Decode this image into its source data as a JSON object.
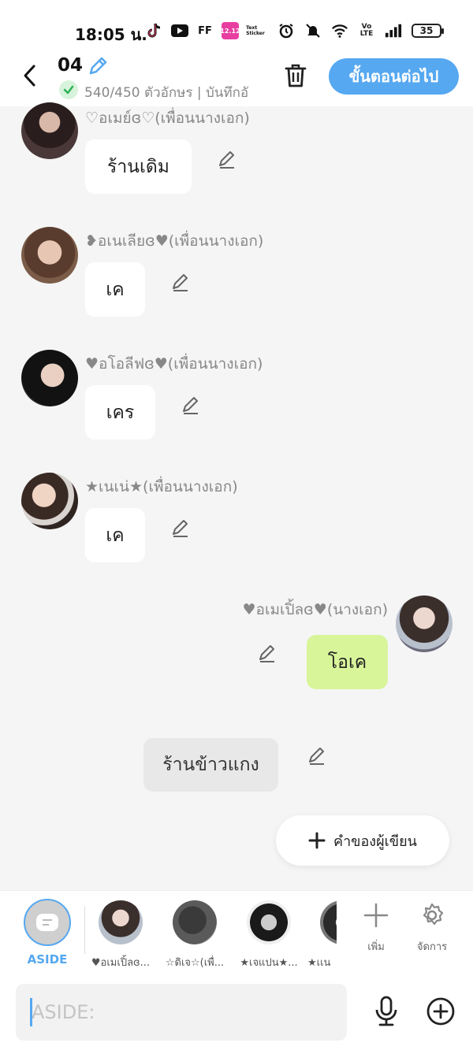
{
  "status_bar": {
    "time": "18:05 น.",
    "battery": "35",
    "app_icons": [
      "tiktok-icon",
      "youtube-icon",
      "ff-icon",
      "shopee-icon",
      "text-sticker-icon"
    ],
    "ff_label": "FF",
    "text_sticker_label": "Text\nSticker",
    "status_icons": [
      "alarm-icon",
      "mute-icon",
      "wifi-icon",
      "volte-icon",
      "signal-icon"
    ]
  },
  "header": {
    "episode": "04",
    "char_count": "540/450 ตัวอักษร | บันทึกอั",
    "next_label": "ขั้นตอนต่อไป"
  },
  "messages": [
    {
      "sender": "♡อเมย์ɞ♡(เพื่อนนางเอก)",
      "text": "ร้านเดิม",
      "side": "left"
    },
    {
      "sender": "❥อเนเลียɞ♥(เพื่อนนางเอก)",
      "text": "เค",
      "side": "left"
    },
    {
      "sender": "♥อโอลีฟɞ♥(เพื่อนนางเอก)",
      "text": "เคร",
      "side": "left"
    },
    {
      "sender": "★เนเน่★(เพื่อนนางเอก)",
      "text": "เค",
      "side": "left"
    },
    {
      "sender": "♥อเมเปิ้ลɞ♥(นางเอก)",
      "text": "โอเค",
      "side": "right"
    }
  ],
  "narration": {
    "text": "ร้านข้าวแกง"
  },
  "author_button": {
    "label": "คำของผู้เขียน"
  },
  "character_bar": {
    "aside_label": "ASIDE",
    "characters": [
      {
        "name": "♥อเมเปิ้ลɞ..."
      },
      {
        "name": "☆ดิเจ☆(เพื่..."
      },
      {
        "name": "★เจแปน★..."
      },
      {
        "name": "★เเน"
      }
    ],
    "add_label": "เพิ่ม",
    "manage_label": "จัดการ"
  },
  "input": {
    "placeholder": "ASIDE:"
  },
  "colors": {
    "accent": "#56a8f0",
    "me_bubble": "#d8f59a",
    "background": "#f5f5f5"
  }
}
